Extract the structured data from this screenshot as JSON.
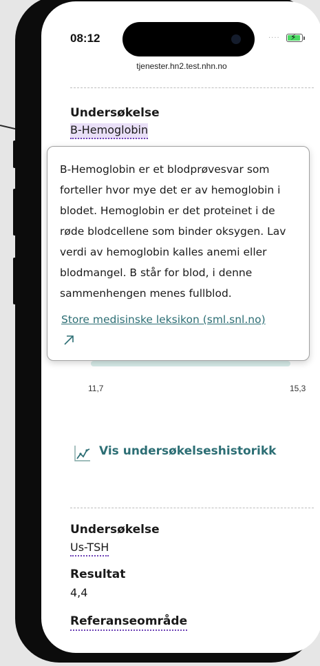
{
  "status_bar": {
    "time": "08:12"
  },
  "browser": {
    "url": "tjenester.hn2.test.nhn.no"
  },
  "result_1": {
    "exam_label": "Undersøkelse",
    "exam_value": "B-Hemoglobin"
  },
  "tooltip": {
    "text": "B-Hemoglobin er et blodprøvesvar som forteller hvor mye det er av hemoglobin i blodet. Hemoglobin er det proteinet i de røde blodcellene som binder oksygen. Lav verdi av hemoglobin kalles anemi eller blodmangel. B står for blod, i denne sammenhengen menes fullblod.",
    "link_label": "Store medisinske leksikon (sml.snl.no)"
  },
  "reference_range": {
    "low": "11,7",
    "high": "15,3"
  },
  "history_button": {
    "label": "Vis undersøkelseshistorikk"
  },
  "result_2": {
    "exam_label": "Undersøkelse",
    "exam_value": "Us-TSH",
    "result_label": "Resultat",
    "result_value": "4,4",
    "reference_label": "Referanseområde"
  },
  "icons": {
    "external_link": "external-link-arrow-icon",
    "history": "line-chart-icon",
    "battery": "battery-charging-icon"
  },
  "colors": {
    "accent": "#2c6e74",
    "term_underline": "#6b3fb5",
    "term_highlight": "#e9dff7",
    "battery": "#4cd964"
  }
}
